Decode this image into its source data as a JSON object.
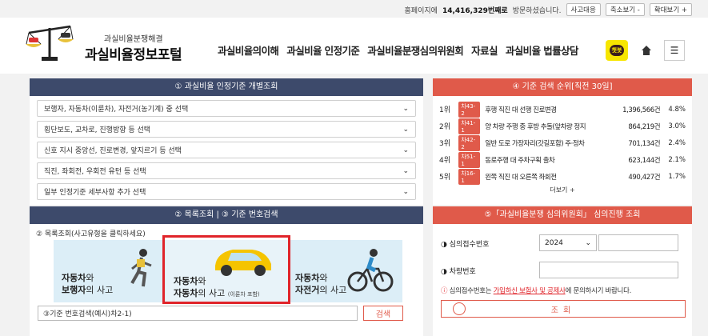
{
  "topbar": {
    "visit_prefix": "홈페이지에",
    "visit_count": "14,416,329번째로",
    "visit_suffix": "방문하셨습니다.",
    "btn_prev": "사고대응",
    "btn_zoom_out": "축소보기 -",
    "btn_zoom_in": "확대보기 +"
  },
  "logo": {
    "sub": "과실비율분쟁해결",
    "main": "과실비율정보포털"
  },
  "nav": [
    "과실비율의이해",
    "과실비율 인정기준",
    "과실비율분쟁심의위원회",
    "자료실",
    "과실비율 법률상담"
  ],
  "talk_label": "챗봇",
  "left1": {
    "title": "① 과실비율 인정기준 개별조회",
    "selects": [
      "보행자, 자동차(이륜차), 자전거(농기계) 중 선택",
      "횡단보도, 교차로, 진행방향 등 선택",
      "신호 지시 중앙선, 진로변경, 앞지르기 등 선택",
      "직진, 좌회전, 우회전 유턴 등 선택",
      "일부 인정기준 세부사항 추가 선택"
    ]
  },
  "left2": {
    "title": "② 목록조회 | ③ 기준 번호검색",
    "list_label": "② 목록조회(사고유형을 클릭하세요)",
    "cards": [
      {
        "l1a": "자동차",
        "l1b": "와",
        "l2a": "보행자",
        "l2b": "의 사고",
        "small": ""
      },
      {
        "l1a": "자동차",
        "l1b": "와",
        "l2a": "자동차",
        "l2b": "의 사고",
        "small": "(이륜차 포함)"
      },
      {
        "l1a": "자동차",
        "l1b": "와",
        "l2a": "자전거",
        "l2b": "의 사고",
        "small": ""
      }
    ],
    "search_placeholder": "③기준 번호검색(예시)차2-1)",
    "search_btn": "검색"
  },
  "right1": {
    "title": "④ 기준 검색 순위[직전 30일]",
    "ranks": [
      {
        "no": "1위",
        "tag": "차43-2",
        "title": "후행 직진 대 선행 진로변경",
        "count": "1,396,566건",
        "pct": "4.8%"
      },
      {
        "no": "2위",
        "tag": "차41-1",
        "title": "양 차량 주행 중 후방 추돌(앞차량 정지",
        "count": "864,219건",
        "pct": "3.0%"
      },
      {
        "no": "3위",
        "tag": "차42-2",
        "title": "일반 도로 가장자리(갓길포함) 주·정차",
        "count": "701,134건",
        "pct": "2.4%"
      },
      {
        "no": "4위",
        "tag": "차51-1",
        "title": "동로주행 대 주차구획 출차",
        "count": "623,144건",
        "pct": "2.1%"
      },
      {
        "no": "5위",
        "tag": "차16-1",
        "title": "왼쪽 직진 대 오른쪽 좌회전",
        "count": "490,427건",
        "pct": "1.7%"
      }
    ],
    "more": "더보기 +"
  },
  "right2": {
    "title": "⑤「과실비율분쟁 심의위원회」 심의진행 조회",
    "label_case": "◑ 심의접수번호",
    "year": "2024",
    "label_car": "◑ 차량번호",
    "notice_pre": "심의접수번호는 ",
    "notice_link": "가입하신 보험사 및 공제사",
    "notice_post": "에 문의하시기 바랍니다.",
    "lookup": "조회"
  },
  "colors": {
    "navy": "#3d4a6b",
    "red": "#e05a4a",
    "highlight": "#e0242a"
  }
}
